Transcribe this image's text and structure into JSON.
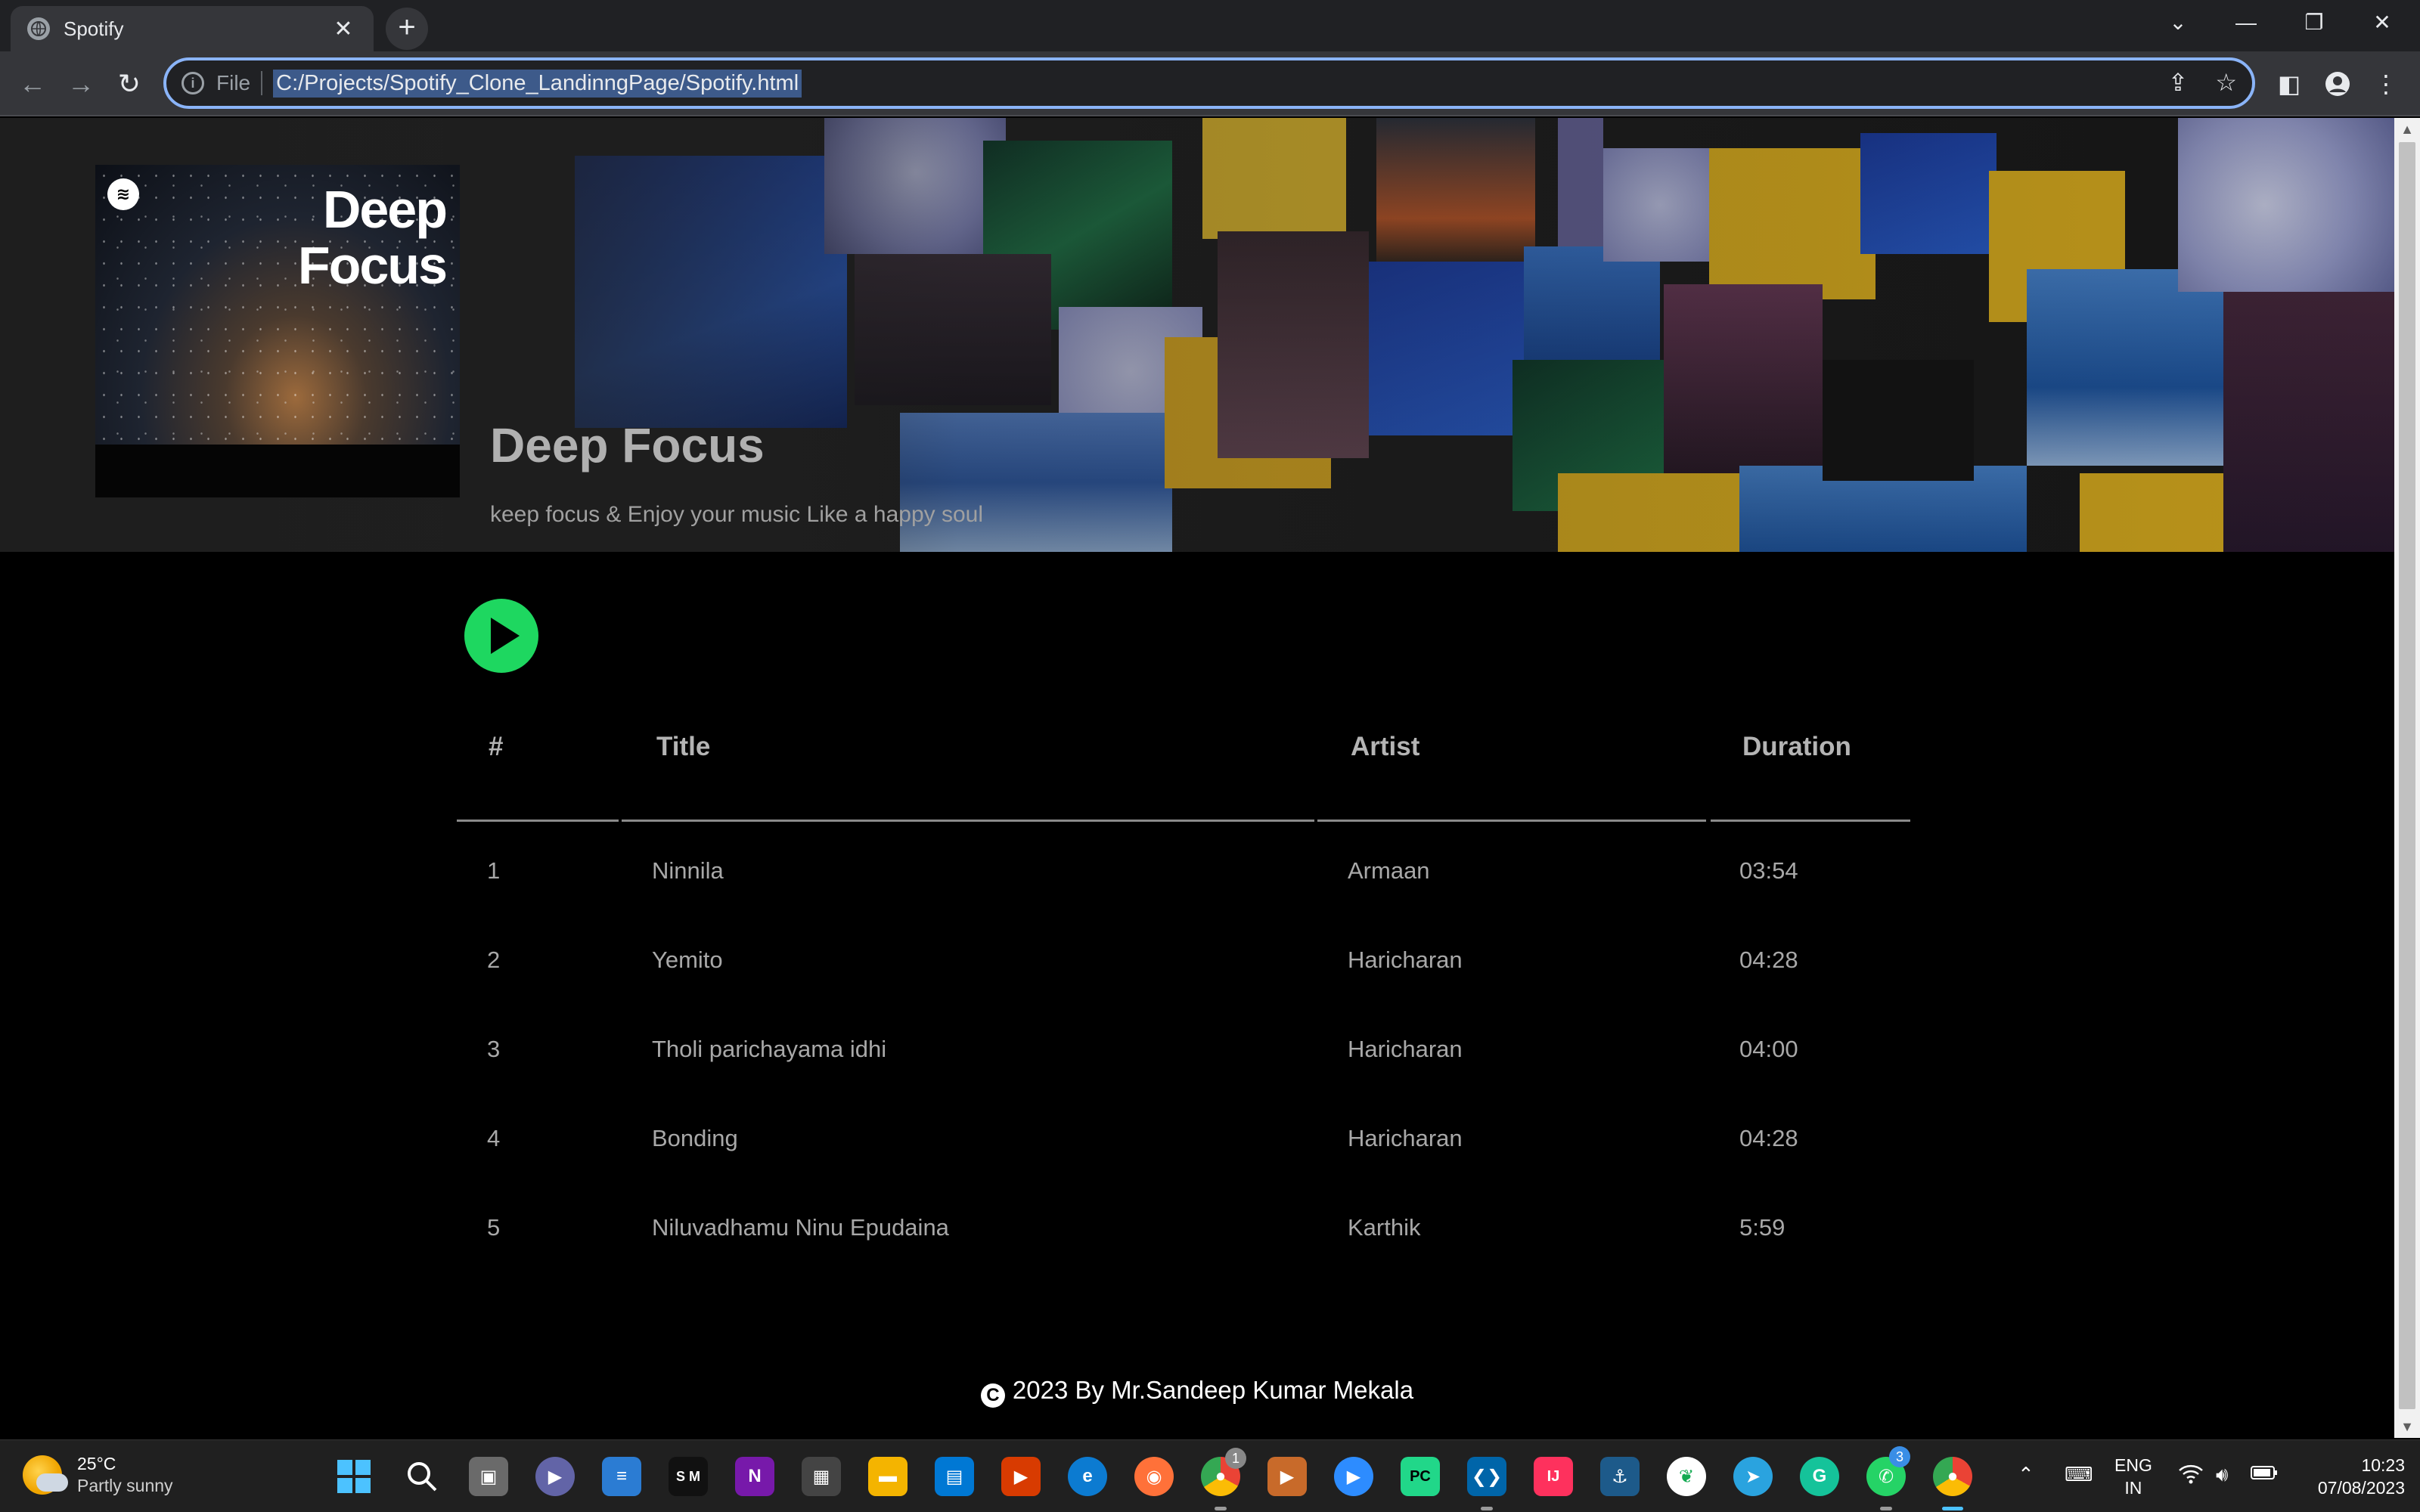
{
  "browser": {
    "tab_title": "Spotify",
    "tab_close": "✕",
    "new_tab": "+",
    "omnibox_scheme": "File",
    "omnibox_url": "C:/Projects/Spotify_Clone_LandinngPage/Spotify.html"
  },
  "hero": {
    "cover_title_line1": "Deep",
    "cover_title_line2": "Focus",
    "title": "Deep Focus",
    "subtitle": "keep focus & Enjoy your music Like a happy soul"
  },
  "table": {
    "headers": [
      "#",
      "Title",
      "Artist",
      "Duration"
    ],
    "rows": [
      {
        "num": "1",
        "title": "Ninnila",
        "artist": "Armaan",
        "duration": "03:54"
      },
      {
        "num": "2",
        "title": "Yemito",
        "artist": "Haricharan",
        "duration": "04:28"
      },
      {
        "num": "3",
        "title": "Tholi parichayama idhi",
        "artist": "Haricharan",
        "duration": "04:00"
      },
      {
        "num": "4",
        "title": "Bonding",
        "artist": "Haricharan",
        "duration": "04:28"
      },
      {
        "num": "5",
        "title": "Niluvadhamu Ninu Epudaina",
        "artist": "Karthik",
        "duration": "5:59"
      }
    ]
  },
  "footer": {
    "copyright_symbol": "C",
    "text": "2023 By Mr.Sandeep Kumar Mekala"
  },
  "taskbar": {
    "weather_temp": "25°C",
    "weather_condition": "Partly sunny",
    "lang_line1": "ENG",
    "lang_line2": "IN",
    "time": "10:23",
    "date": "07/08/2023",
    "chrome_badge": "1",
    "whatsapp_badge": "3"
  },
  "colors": {
    "accent_green": "#1ed760",
    "omnibox_focus": "#8ab4f8",
    "page_bg": "#000000"
  },
  "icons": {
    "back": "arrow-left-icon",
    "forward": "arrow-right-icon",
    "reload": "reload-icon",
    "info": "info-icon",
    "share": "share-icon",
    "bookmark": "star-icon",
    "side_panel": "side-panel-icon",
    "profile": "profile-icon",
    "menu": "kebab-menu-icon",
    "play": "play-icon"
  }
}
